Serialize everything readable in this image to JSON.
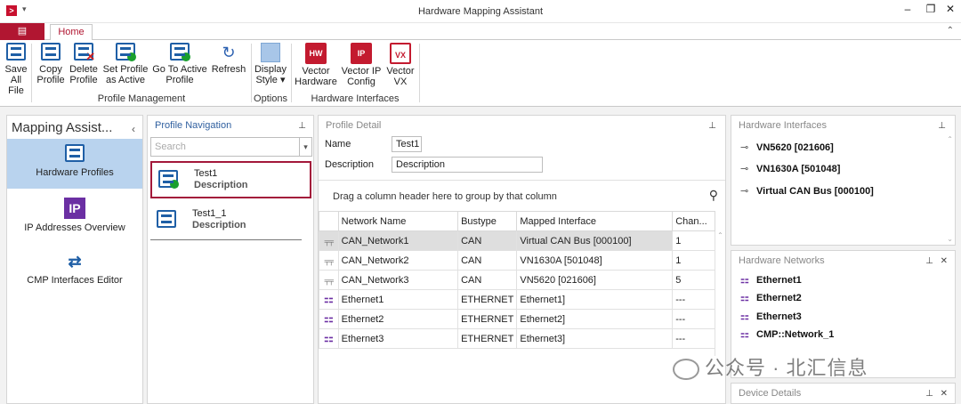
{
  "window": {
    "title": "Hardware Mapping Assistant"
  },
  "tabs": {
    "file": "▤",
    "home": "Home"
  },
  "ribbon": {
    "buttons": [
      {
        "label1": "Save",
        "label2": "All",
        "label3": "File"
      },
      {
        "label1": "Copy",
        "label2": "Profile"
      },
      {
        "label1": "Delete",
        "label2": "Profile"
      },
      {
        "label1": "Set Profile",
        "label2": "as Active"
      },
      {
        "label1": "Go To Active",
        "label2": "Profile"
      },
      {
        "label1": "Refresh"
      },
      {
        "label1": "Display",
        "label2": "Style ▾"
      },
      {
        "label1": "Vector",
        "label2": "Hardware"
      },
      {
        "label1": "Vector IP",
        "label2": "Config"
      },
      {
        "label1": "Vector",
        "label2": "VX"
      }
    ],
    "groups": {
      "profile": "Profile Management",
      "options": "Options",
      "hardware": "Hardware Interfaces"
    }
  },
  "left": {
    "title": "Mapping Assist...",
    "items": [
      "Hardware Profiles",
      "IP Addresses Overview",
      "CMP Interfaces Editor"
    ]
  },
  "nav": {
    "title": "Profile Navigation",
    "search_placeholder": "Search",
    "profiles": [
      {
        "name": "Test1",
        "desc": "Description"
      },
      {
        "name": "Test1_1",
        "desc": "Description"
      }
    ]
  },
  "detail": {
    "title": "Profile Detail",
    "name_label": "Name",
    "name_value": "Test1",
    "desc_label": "Description",
    "desc_value": "Description",
    "group_hint": "Drag a column header here to group by that column",
    "columns": [
      "Network Name",
      "Bustype",
      "Mapped Interface",
      "Chan..."
    ],
    "rows": [
      {
        "type": "can",
        "cells": [
          "CAN_Network1",
          "CAN",
          "Virtual CAN Bus [000100]",
          "1"
        ]
      },
      {
        "type": "can",
        "cells": [
          "CAN_Network2",
          "CAN",
          "VN1630A [501048]",
          "1"
        ]
      },
      {
        "type": "can",
        "cells": [
          "CAN_Network3",
          "CAN",
          "VN5620 [021606]",
          "5"
        ]
      },
      {
        "type": "eth",
        "cells": [
          "Ethernet1",
          "ETHERNET",
          "Ethernet1]",
          "---"
        ]
      },
      {
        "type": "eth",
        "cells": [
          "Ethernet2",
          "ETHERNET",
          "Ethernet2]",
          "---"
        ]
      },
      {
        "type": "eth",
        "cells": [
          "Ethernet3",
          "ETHERNET",
          "Ethernet3]",
          "---"
        ]
      }
    ]
  },
  "hw_interfaces": {
    "title": "Hardware Interfaces",
    "items": [
      "VN5620 [021606]",
      "VN1630A [501048]",
      "Virtual CAN Bus [000100]"
    ]
  },
  "hw_networks": {
    "title": "Hardware Networks",
    "items": [
      "Ethernet1",
      "Ethernet2",
      "Ethernet3",
      "CMP::Network_1"
    ]
  },
  "device_details": {
    "title": "Device Details"
  },
  "watermark": "公众号 · 北汇信息"
}
